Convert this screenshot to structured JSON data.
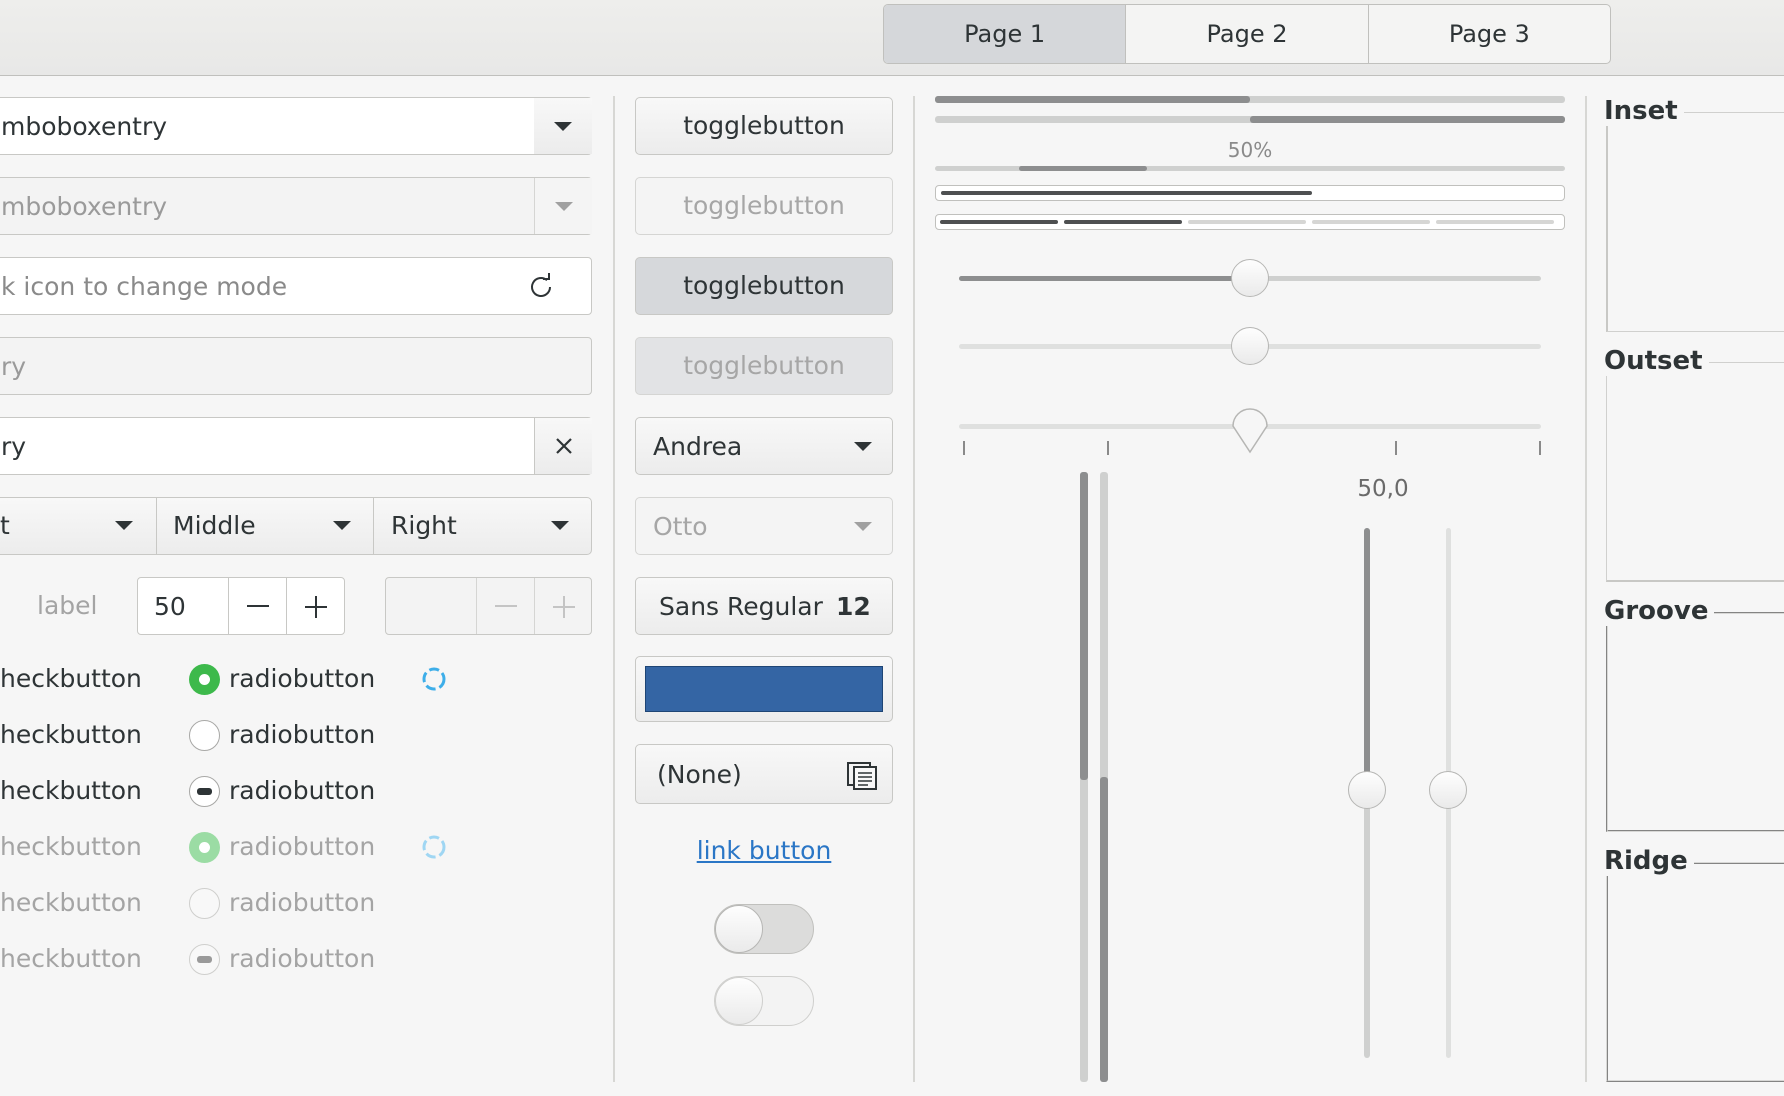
{
  "tabs": [
    "Page 1",
    "Page 2",
    "Page 3"
  ],
  "left": {
    "combo_entry_1": "mboboxentry",
    "combo_entry_2": "mboboxentry",
    "mode_entry_placeholder": "k icon to change mode",
    "entry_disabled": "ry",
    "entry_clear": "ry",
    "combo_row": [
      "t",
      "Middle",
      "Right"
    ],
    "spin_label": "label",
    "spin_value": "50",
    "check_label": "heckbutton",
    "radio_label": "radiobutton"
  },
  "middle": {
    "toggle_label": "togglebutton",
    "combo_andrea": "Andrea",
    "combo_otto": "Otto",
    "font_name": "Sans Regular",
    "font_size": "12",
    "color_value": "#3465a4",
    "file_chooser": "(None)",
    "link": "link button",
    "switch_1_on": false,
    "switch_2_on": false
  },
  "right": {
    "progress_top_1": 0.5,
    "progress_top_2_start": 0.5,
    "progress_text": "50%",
    "progress_osd": 0.6,
    "level_bar": 0.6,
    "segmented_filled": 2,
    "segmented_total": 5,
    "scale_value": 50,
    "scale_value_label": "50,0"
  },
  "frames": [
    "Inset",
    "Outset",
    "Groove",
    "Ridge"
  ],
  "colors": {
    "accent_green": "#3db94b",
    "spinner_blue": "#3daee9",
    "link_blue": "#2a76c6"
  }
}
